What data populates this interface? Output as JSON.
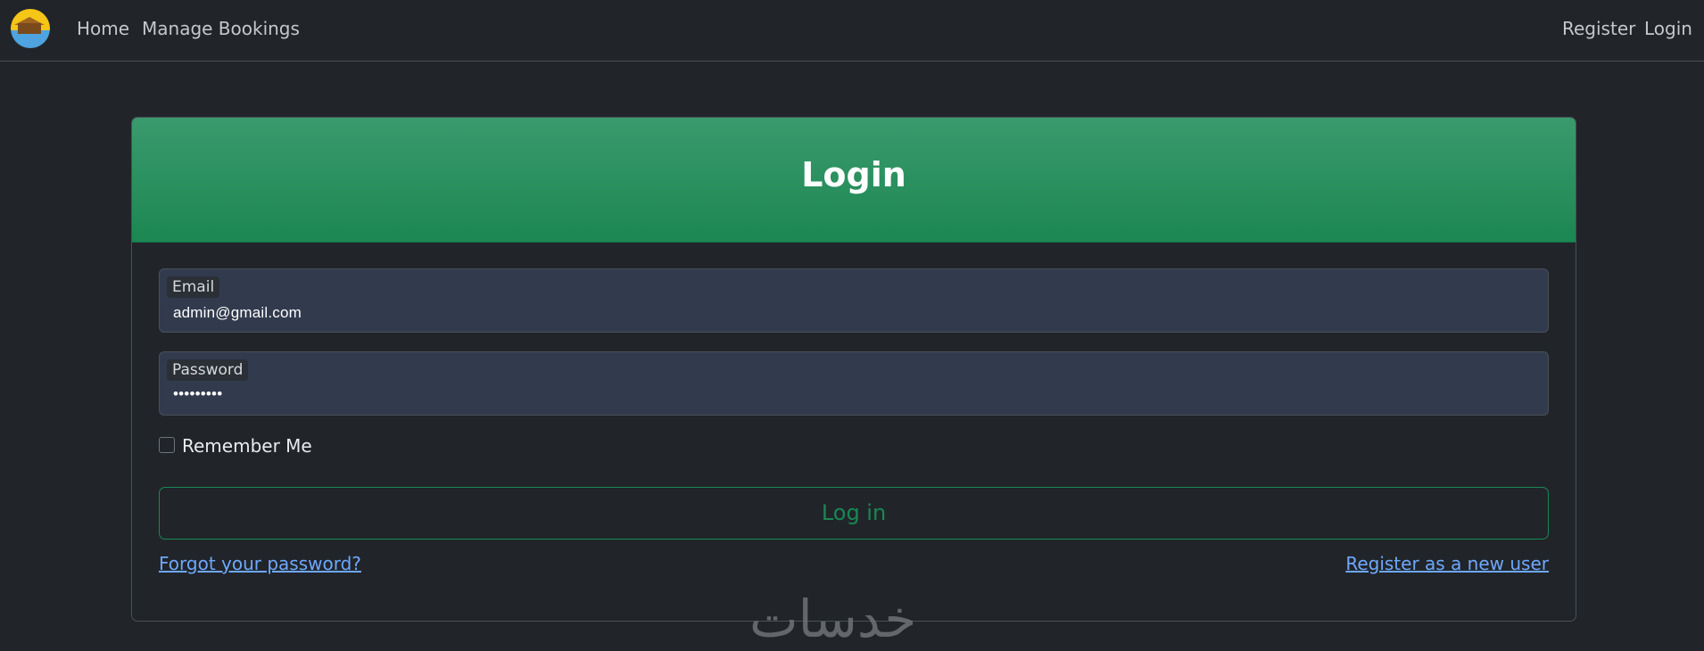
{
  "nav": {
    "logo": "hotel-logo",
    "home": "Home",
    "manage_bookings": "Manage Bookings",
    "register": "Register",
    "login": "Login"
  },
  "form": {
    "title": "Login",
    "email_label": "Email",
    "email_value": "admin@gmail.com",
    "password_label": "Password",
    "password_value": "•••••••••",
    "remember_me": "Remember Me",
    "remember_checked": false,
    "submit": "Log in",
    "forgot_password": "Forgot your password?",
    "register_new": "Register as a new user"
  },
  "watermark": "خدسات",
  "colors": {
    "background": "#212529",
    "header_green": "#198754",
    "field_bg": "#323b4e",
    "link": "#6ea8fe"
  }
}
